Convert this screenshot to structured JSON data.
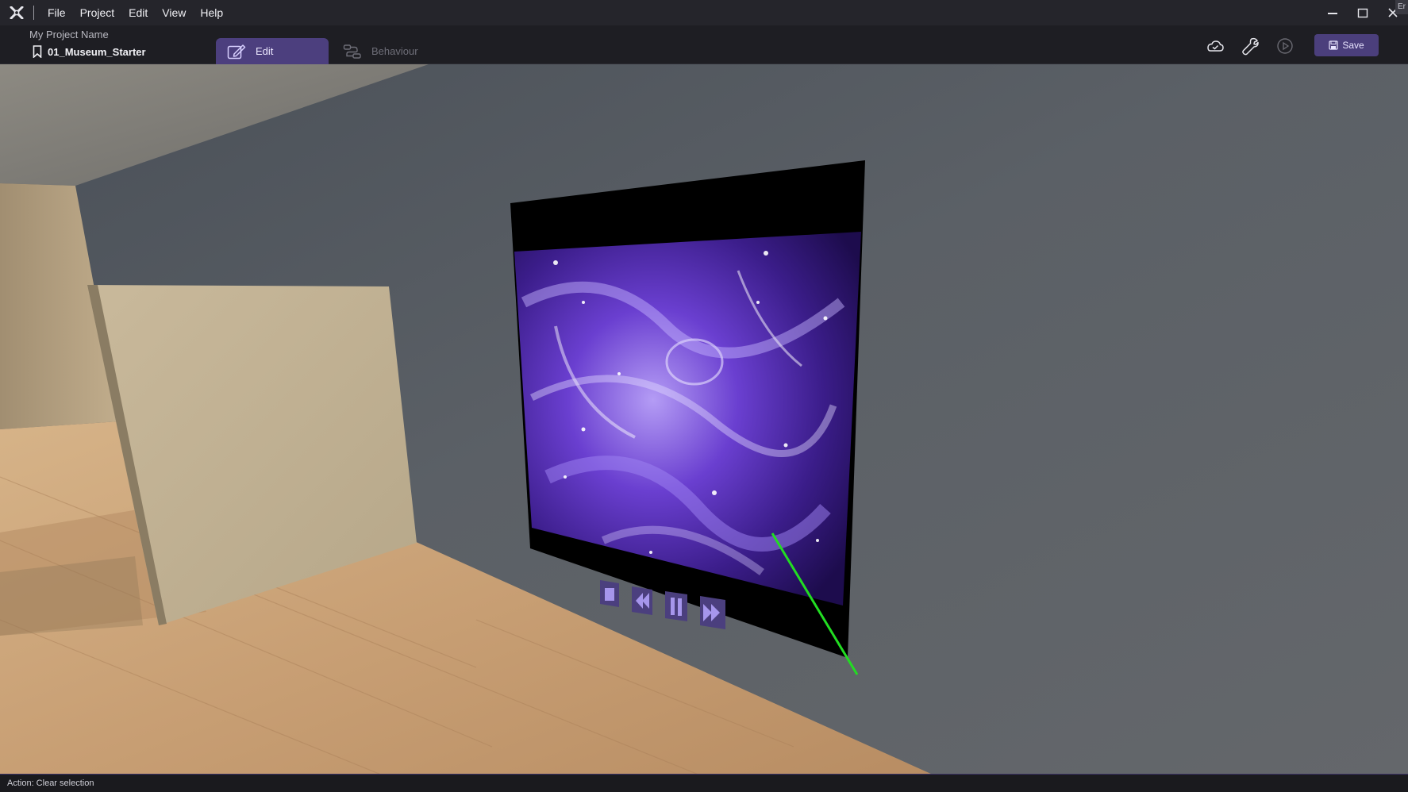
{
  "menubar": {
    "items": [
      {
        "label": "File"
      },
      {
        "label": "Project"
      },
      {
        "label": "Edit"
      },
      {
        "label": "View"
      },
      {
        "label": "Help"
      }
    ],
    "corner_tag": "Er"
  },
  "toolbar": {
    "project_name": "My Project Name",
    "scene_name": "01_Museum_Starter",
    "tabs": [
      {
        "label": "Edit",
        "active": true
      },
      {
        "label": "Behaviour",
        "active": false
      }
    ],
    "icons": [
      "cloud-sync-icon",
      "wrench-icon",
      "play-icon"
    ],
    "save_label": "Save"
  },
  "viewport": {
    "media_controls": [
      "stop-icon",
      "rewind-icon",
      "pause-icon",
      "fast-forward-icon"
    ]
  },
  "status": {
    "text": "Action: Clear selection"
  },
  "colors": {
    "accent": "#4c3f7e",
    "gizmo_line": "#22dd22",
    "wall": "#5a5e64",
    "floor": "#c9a47c"
  }
}
